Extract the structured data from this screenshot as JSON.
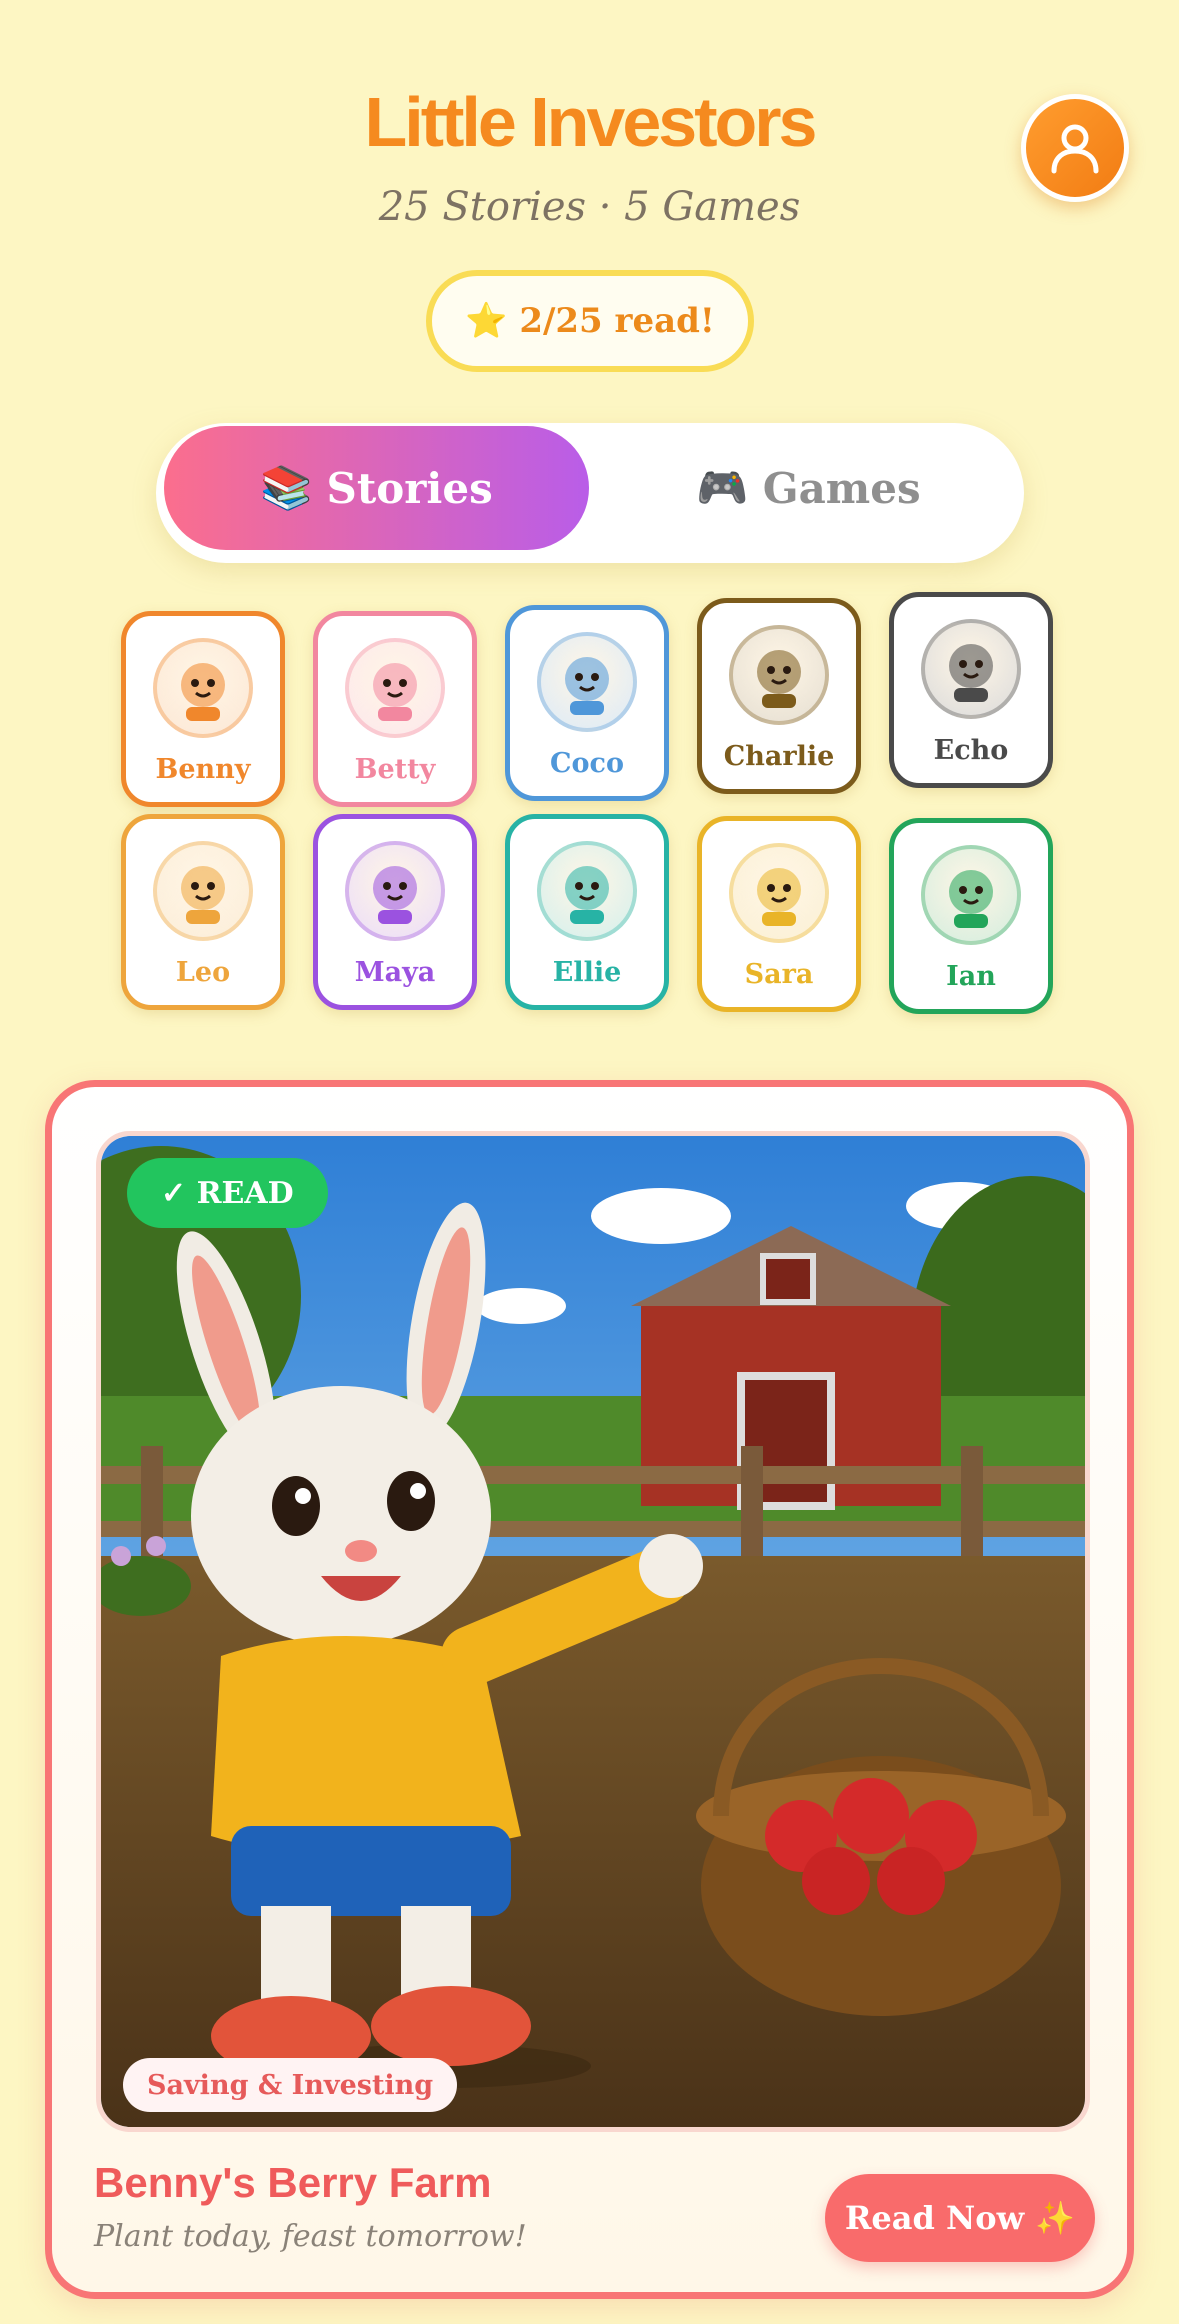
{
  "header": {
    "title": "Little Investors",
    "subtitle": "25 Stories · 5 Games",
    "progress": "⭐ 2/25 read!",
    "profile_icon": "user-icon"
  },
  "tabs": [
    {
      "label": "Stories",
      "emoji": "📚",
      "active": true
    },
    {
      "label": "Games",
      "emoji": "🎮",
      "active": false
    }
  ],
  "characters": [
    {
      "name": "Benny",
      "color": "#f0872c"
    },
    {
      "name": "Betty",
      "color": "#f2879f"
    },
    {
      "name": "Coco",
      "color": "#4f97d9"
    },
    {
      "name": "Charlie",
      "color": "#7c5b1b"
    },
    {
      "name": "Echo",
      "color": "#4a4a4a"
    },
    {
      "name": "Leo",
      "color": "#eea53c"
    },
    {
      "name": "Maya",
      "color": "#9b52e0"
    },
    {
      "name": "Ellie",
      "color": "#27b3a5"
    },
    {
      "name": "Sara",
      "color": "#e9b428"
    },
    {
      "name": "Ian",
      "color": "#23a55a"
    }
  ],
  "featured_story": {
    "badge": "✓ READ",
    "category": "Saving & Investing",
    "title": "Benny's Berry Farm",
    "tagline": "Plant today, feast tomorrow!",
    "button": "Read Now ✨"
  }
}
